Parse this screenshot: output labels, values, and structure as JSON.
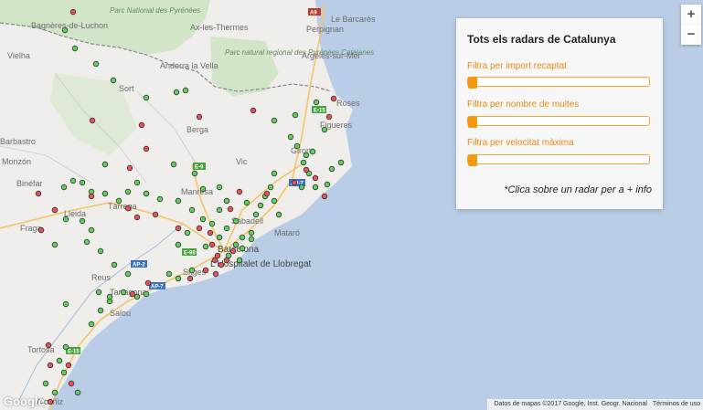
{
  "map": {
    "places": [
      "Vielha",
      "Bagnères-de-Luchon",
      "Parc National des Pyrénées",
      "Ax-les-Thermes",
      "Andorra la Vella",
      "Perpignan",
      "Le Barcarès",
      "Parc natural regional des Pyrénées Catalanes",
      "Argelès-sur-Mer",
      "Berga",
      "Girona",
      "Roses",
      "Barbastro",
      "Monzón",
      "Binéfar",
      "Lleida",
      "Fraga",
      "Tàrrega",
      "Manresa",
      "Sabadell",
      "Barcelona",
      "L'Hospitalet de Llobregat",
      "Sitges",
      "Tarragona",
      "Salou",
      "Tortosa",
      "Alcañiz",
      "Sort",
      "Vic",
      "Figueres",
      "Mataró",
      "Reus"
    ],
    "roads": [
      "A9",
      "E-15",
      "E-9",
      "AP-7",
      "E-90",
      "AP-2",
      "AP-7",
      "E-15"
    ],
    "markers_green_icon": "radar-marker-green",
    "markers_red_icon": "radar-marker-red"
  },
  "panel": {
    "title": "Tots els radars de Catalunya",
    "filters": [
      {
        "label": "Filtra per import recaptat",
        "value": 0
      },
      {
        "label": "Filtra per nombre de multes",
        "value": 0
      },
      {
        "label": "Filtra per velocitat màxima",
        "value": 0
      }
    ],
    "note": "*Clica sobre un radar per a + info"
  },
  "controls": {
    "zoom_in": "+",
    "zoom_out": "−"
  },
  "attribution": {
    "data": "Datos de mapas ©2017 Google, Inst. Geogr. Nacional",
    "terms": "Términos de uso"
  },
  "logo": "Google",
  "colors": {
    "accent": "#f39a10",
    "marker_green": "#5bd35b",
    "marker_red": "#e8505a",
    "sea": "#b9cde6",
    "land": "#efeeea"
  }
}
